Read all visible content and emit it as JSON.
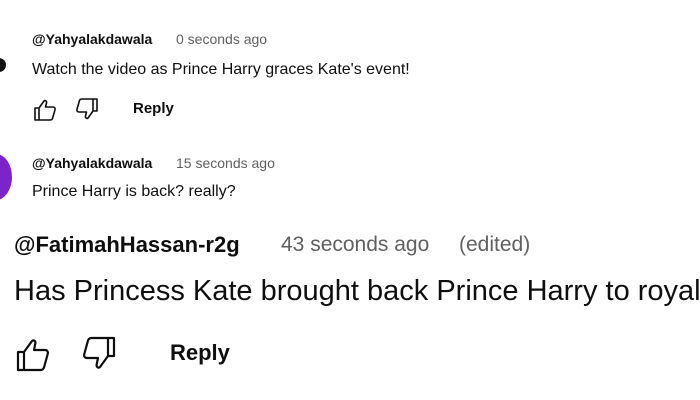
{
  "comments": [
    {
      "author": "@Yahyalakdawala",
      "time": "0 seconds ago",
      "text": "Watch the video as Prince Harry graces Kate's event!",
      "reply_label": "Reply"
    },
    {
      "author": "@Yahyalakdawala",
      "time": "15 seconds ago",
      "text": "Prince Harry is back? really?"
    },
    {
      "author": "@FatimahHassan-r2g",
      "time": "43 seconds ago",
      "edited": "(edited)",
      "text": "Has Princess Kate brought back Prince Harry to royal e",
      "reply_label": "Reply"
    }
  ],
  "icons": {
    "like": "thumbs-up-icon",
    "dislike": "thumbs-down-icon"
  },
  "colors": {
    "avatar_dark": "#111111",
    "avatar_purple": "#7b24c9",
    "secondary_text": "#606060"
  }
}
